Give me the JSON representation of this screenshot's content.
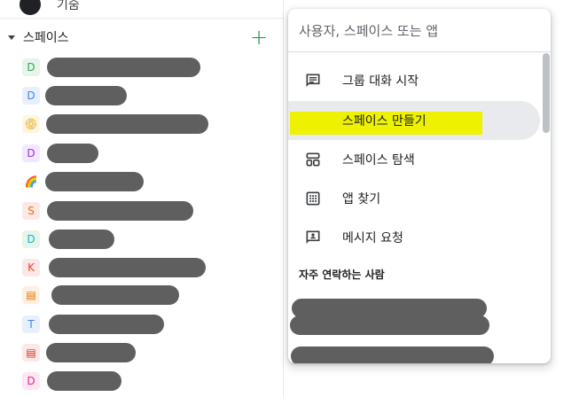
{
  "sidebar": {
    "top_item": {
      "label": "기숨"
    },
    "section": {
      "title": "스페이스",
      "add_icon": "plus-icon",
      "add_color": "#1e8e3e"
    },
    "spaces": [
      {
        "avatar_text": "D",
        "avatar_bg": "#e6f4ea",
        "avatar_fg": "#34a853"
      },
      {
        "avatar_text": "D",
        "avatar_bg": "#e8f0fe",
        "avatar_fg": "#4285f4"
      },
      {
        "avatar_text": "📀",
        "avatar_bg": "#fef7e0",
        "avatar_fg": "#f9ab00"
      },
      {
        "avatar_text": "D",
        "avatar_bg": "#f3e8fd",
        "avatar_fg": "#9334e6"
      },
      {
        "avatar_text": "🌈",
        "avatar_bg": "#ffffff",
        "avatar_fg": "#202124"
      },
      {
        "avatar_text": "S",
        "avatar_bg": "#fce8e6",
        "avatar_fg": "#e37400"
      },
      {
        "avatar_text": "D",
        "avatar_bg": "#e6f4ea",
        "avatar_fg": "#12b5cb"
      },
      {
        "avatar_text": "K",
        "avatar_bg": "#fce8e6",
        "avatar_fg": "#ea4335"
      },
      {
        "avatar_text": "▤",
        "avatar_bg": "#feefe3",
        "avatar_fg": "#e37400"
      },
      {
        "avatar_text": "T",
        "avatar_bg": "#e8f0fe",
        "avatar_fg": "#4285f4"
      },
      {
        "avatar_text": "▤",
        "avatar_bg": "#fce8e6",
        "avatar_fg": "#d93025"
      },
      {
        "avatar_text": "D",
        "avatar_bg": "#fde7f3",
        "avatar_fg": "#e52592"
      }
    ]
  },
  "popup": {
    "search_placeholder": "사용자, 스페이스 또는 앱",
    "menu": [
      {
        "label": "그룹 대화 시작",
        "icon": "chat-bubble-icon"
      },
      {
        "label": "스페이스 만들기",
        "icon": "people-add-icon"
      },
      {
        "label": "스페이스 탐색",
        "icon": "spaces-grid-icon"
      },
      {
        "label": "앱 찾기",
        "icon": "apps-grid-icon"
      },
      {
        "label": "메시지 요청",
        "icon": "message-request-icon"
      }
    ],
    "frequent_title": "자주 연락하는 사람"
  },
  "colors": {
    "highlight": "#eef200",
    "redaction": "#5f5f5f",
    "active_row": "#e8eaed"
  }
}
